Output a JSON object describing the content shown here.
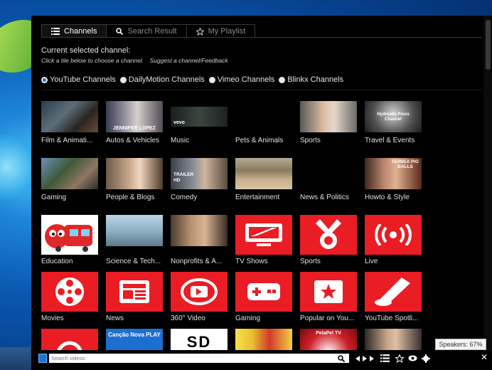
{
  "tabs": [
    {
      "label": "Channels",
      "icon": "list-icon",
      "active": true
    },
    {
      "label": "Search Result",
      "icon": "search-icon",
      "active": false
    },
    {
      "label": "My Playlist",
      "icon": "star-icon",
      "active": false
    }
  ],
  "current_channel_label": "Current selected channel:",
  "hint": {
    "part1": "Click a tile below to choose a channel.",
    "part2": "Suggest a channel/Feedback"
  },
  "sources": [
    {
      "label": "YouTube Channels",
      "selected": true
    },
    {
      "label": "DailyMotion Channels",
      "selected": false
    },
    {
      "label": "Vimeo Channels",
      "selected": false
    },
    {
      "label": "Blinkx Channels",
      "selected": false
    }
  ],
  "tiles": [
    {
      "label": "Film & Animati...",
      "kind": "photo"
    },
    {
      "label": "Autos & Vehicles",
      "kind": "photo",
      "overlay": "JENNIFER LOPEZ"
    },
    {
      "label": "Music",
      "kind": "photo",
      "overlay": "vevo"
    },
    {
      "label": "Pets & Animals",
      "kind": "empty"
    },
    {
      "label": "Sports",
      "kind": "photo"
    },
    {
      "label": "Travel & Events",
      "kind": "photo",
      "overlay": "Hydraulic Press Channel"
    },
    {
      "label": "Gaming",
      "kind": "photo"
    },
    {
      "label": "People & Blogs",
      "kind": "photo"
    },
    {
      "label": "Comedy",
      "kind": "photo",
      "overlay": "TRAILER HD"
    },
    {
      "label": "Entertainment",
      "kind": "photo"
    },
    {
      "label": "News & Politics",
      "kind": "empty"
    },
    {
      "label": "Howto & Style",
      "kind": "photo",
      "overlay": "GUINEA PIG BALLS"
    },
    {
      "label": "Education",
      "kind": "photo"
    },
    {
      "label": "Science & Tech...",
      "kind": "photo"
    },
    {
      "label": "Nonprofits & A...",
      "kind": "photo"
    },
    {
      "label": "TV Shows",
      "kind": "icon",
      "icon": "tv-icon"
    },
    {
      "label": "Sports",
      "kind": "icon",
      "icon": "medal-icon"
    },
    {
      "label": "Live",
      "kind": "icon",
      "icon": "live-broadcast-icon"
    },
    {
      "label": "Movies",
      "kind": "icon",
      "icon": "film-reel-icon"
    },
    {
      "label": "News",
      "kind": "icon",
      "icon": "newspaper-icon"
    },
    {
      "label": "360° Video",
      "kind": "icon",
      "icon": "360-video-icon"
    },
    {
      "label": "Gaming",
      "kind": "icon",
      "icon": "gamepad-icon"
    },
    {
      "label": "Popular on You...",
      "kind": "icon",
      "icon": "star-badge-icon"
    },
    {
      "label": "YouTube Spotli...",
      "kind": "icon",
      "icon": "spotlight-icon"
    },
    {
      "label": "",
      "kind": "icon",
      "icon": "headphones-icon"
    },
    {
      "label": "",
      "kind": "photo",
      "overlay": "Canção Nova PLAY"
    },
    {
      "label": "",
      "kind": "photo",
      "overlay": "SD"
    },
    {
      "label": "",
      "kind": "photo"
    },
    {
      "label": "",
      "kind": "photo",
      "overlay": "PelaPel TV"
    },
    {
      "label": "",
      "kind": "photo"
    }
  ],
  "search": {
    "placeholder": "Search videos"
  },
  "tooltip": "Speakers: 67%",
  "colors": {
    "accent_red": "#ea1d24",
    "radio_blue": "#1c6fd6",
    "background": "#000000"
  }
}
